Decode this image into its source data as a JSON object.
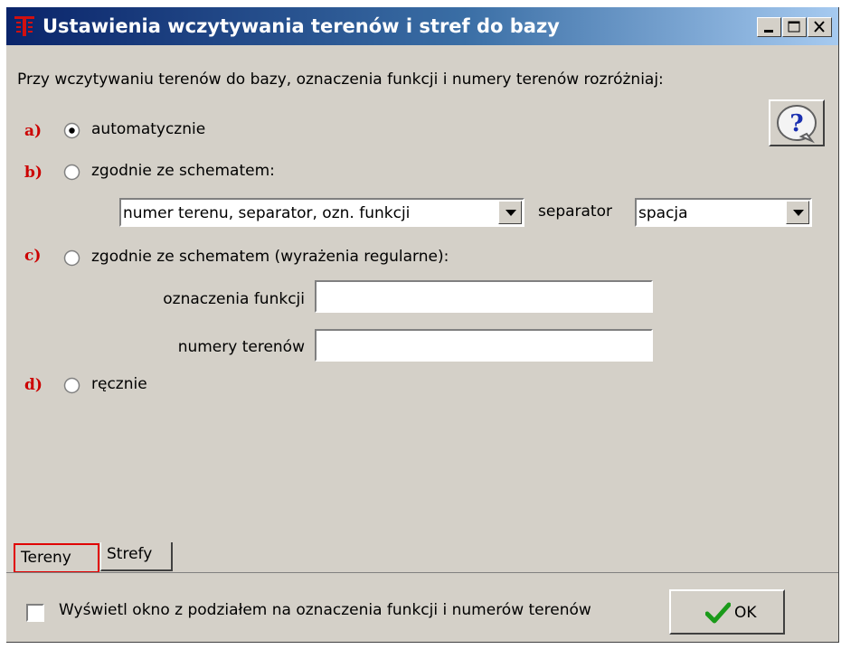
{
  "window": {
    "title": "Ustawienia wczytywania terenów i stref do bazy",
    "title_bar_colors": [
      "#0a246a",
      "#a6caf0"
    ]
  },
  "prompt": "Przy wczytywaniu terenów do bazy, oznaczenia funkcji i numery terenów rozróżniaj:",
  "options": [
    {
      "letter": "a)",
      "label": "automatycznie",
      "selected": true
    },
    {
      "letter": "b)",
      "label": "zgodnie ze schematem:",
      "selected": false
    },
    {
      "letter": "c)",
      "label": "zgodnie ze schematem (wyrażenia regularne):",
      "selected": false
    },
    {
      "letter": "d)",
      "label": "ręcznie",
      "selected": false
    }
  ],
  "schema": {
    "scheme_value": "numer terenu, separator, ozn. funkcji",
    "separator_label": "separator",
    "separator_value": "spacja"
  },
  "regex": {
    "functions_label": "oznaczenia funkcji",
    "functions_value": "",
    "numbers_label": "numery terenów",
    "numbers_value": ""
  },
  "tabs": [
    {
      "label": "Tereny",
      "active": true,
      "highlight_color": "#e00000"
    },
    {
      "label": "Strefy",
      "active": false
    }
  ],
  "footer": {
    "checkbox_label": "Wyświetl okno z podziałem na oznaczenia funkcji i numerów terenów",
    "checkbox_checked": false,
    "ok_label": "OK"
  },
  "icons": {
    "help": "question-mark-icon",
    "ok": "checkmark-icon",
    "app": "app-logo-icon"
  },
  "colors": {
    "face": "#d4d0c8",
    "option_letter": "#cc0000",
    "ok_check": "#1a9a1a"
  }
}
